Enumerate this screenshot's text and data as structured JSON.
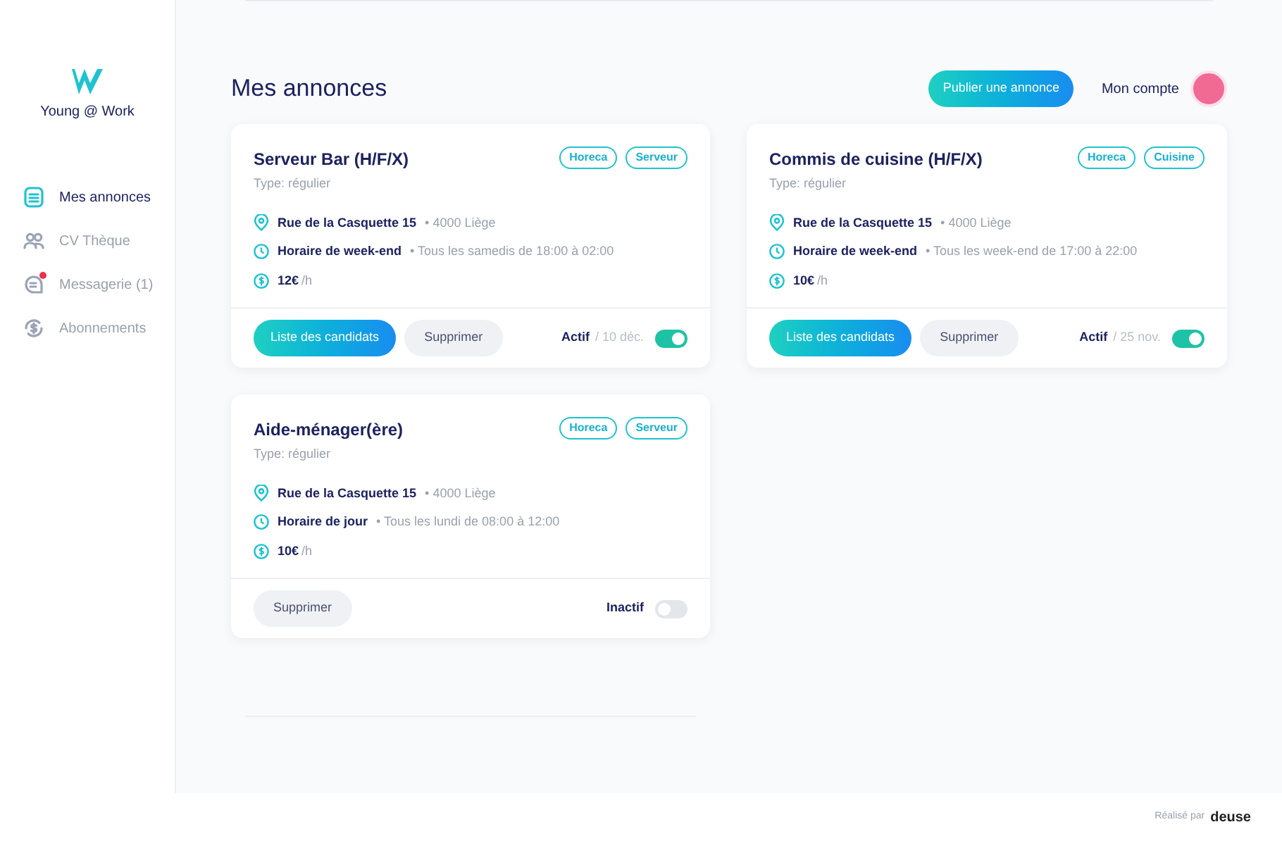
{
  "logo": {
    "text": "Young @ Work"
  },
  "sidebar": {
    "items": [
      {
        "label": "Mes annonces",
        "selected": true,
        "badge": false
      },
      {
        "label": "CV Thèque",
        "selected": false,
        "badge": false
      },
      {
        "label": "Messagerie (1)",
        "selected": false,
        "badge": true
      },
      {
        "label": "Abonnements",
        "selected": false,
        "badge": false
      }
    ]
  },
  "header": {
    "title": "Mes annonces",
    "publish_button": "Publier une annonce",
    "account": "Mon compte"
  },
  "listings": [
    {
      "title": "Serveur Bar (H/F/X)",
      "type": "Type: régulier",
      "tags": [
        "Horeca",
        "Serveur"
      ],
      "address": "Rue de la Casquette 15",
      "city": "• 4000 Liège",
      "schedule": "Horaire de week-end",
      "schedule_detail": "• Tous les samedis de 18:00 à 02:00",
      "pay": "12€",
      "pay_unit": "/h",
      "candidates_button": "Liste des candidats",
      "delete_button": "Supprimer",
      "status": "Actif",
      "date": "/ 10 déc.",
      "on": true
    },
    {
      "title": "Commis de cuisine (H/F/X)",
      "type": "Type: régulier",
      "tags": [
        "Horeca",
        "Cuisine"
      ],
      "address": "Rue de la Casquette 15",
      "city": "• 4000 Liège",
      "schedule": "Horaire de week-end",
      "schedule_detail": "• Tous les week-end de 17:00 à 22:00",
      "pay": "10€",
      "pay_unit": "/h",
      "candidates_button": "Liste des candidats",
      "delete_button": "Supprimer",
      "status": "Actif",
      "date": "/ 25 nov.",
      "on": true
    },
    {
      "title": "Aide-ménager(ère)",
      "type": "Type: régulier",
      "tags": [
        "Horeca",
        "Serveur"
      ],
      "address": "Rue de la Casquette 15",
      "city": "• 4000 Liège",
      "schedule": "Horaire de jour",
      "schedule_detail": "• Tous les lundi de 08:00 à 12:00",
      "pay": "10€",
      "pay_unit": "/h",
      "delete_button": "Supprimer",
      "status": "Inactif",
      "on": false
    }
  ],
  "footer": {
    "credit": "Réalisé par",
    "brand": "deuse"
  }
}
